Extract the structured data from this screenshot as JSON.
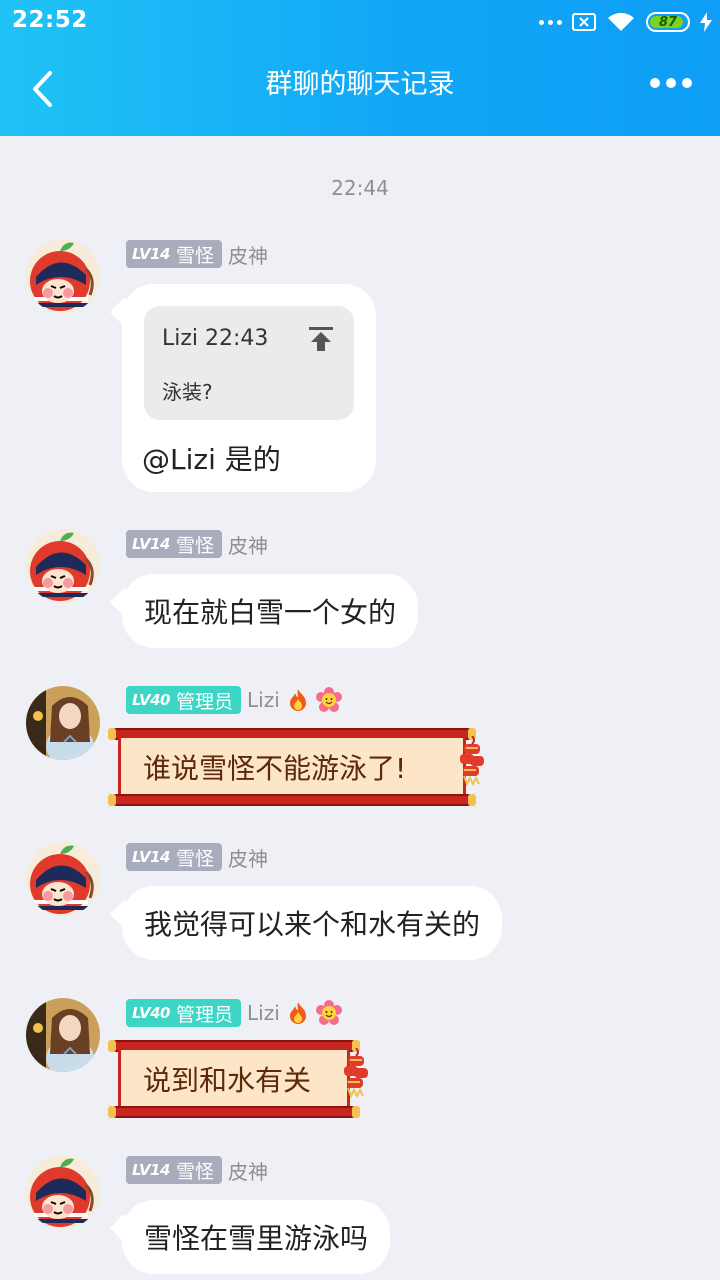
{
  "status_bar": {
    "time": "22:52",
    "battery": "87"
  },
  "nav": {
    "title": "群聊的聊天记录"
  },
  "timestamp": "22:44",
  "messages": [
    {
      "badge_level": "LV14",
      "badge_title": "雪怪",
      "nickname": "皮神",
      "quote": {
        "author_time": "Lizi 22:43",
        "text": "泳装?"
      },
      "text": "@Lizi 是的"
    },
    {
      "badge_level": "LV14",
      "badge_title": "雪怪",
      "nickname": "皮神",
      "text": "现在就白雪一个女的"
    },
    {
      "badge_level": "LV40",
      "badge_title": "管理员",
      "nickname": "Lizi",
      "text": "谁说雪怪不能游泳了!"
    },
    {
      "badge_level": "LV14",
      "badge_title": "雪怪",
      "nickname": "皮神",
      "text": "我觉得可以来个和水有关的"
    },
    {
      "badge_level": "LV40",
      "badge_title": "管理员",
      "nickname": "Lizi",
      "text": "说到和水有关"
    },
    {
      "badge_level": "LV14",
      "badge_title": "雪怪",
      "nickname": "皮神",
      "text": "雪怪在雪里游泳吗"
    }
  ],
  "colors": {
    "header_start": "#1fc3f5",
    "header_end": "#0e9ef6",
    "badge_grey": "#a8adbd",
    "badge_teal": "#3dd5c6",
    "background": "#eef0f5"
  }
}
